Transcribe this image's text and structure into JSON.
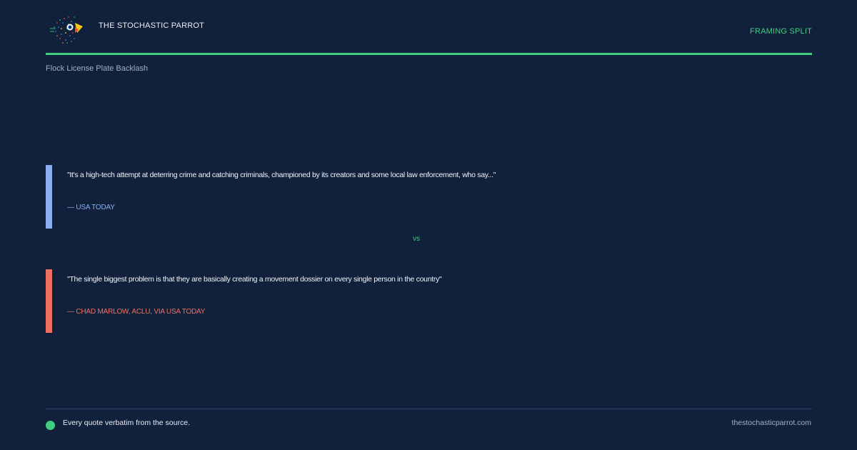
{
  "header": {
    "brand": "THE STOCHASTIC PARROT",
    "section_tag": "FRAMING SPLIT",
    "logo_icon": "parrot-logo-icon"
  },
  "topic": "Flock License Plate Backlash",
  "quotes": [
    {
      "text": "\"It's a high-tech attempt at deterring crime and catching criminals, championed by its creators and some local law enforcement, who say...\"",
      "source": "— USA TODAY",
      "accent": "#8aadef"
    },
    {
      "text": "\"The single biggest problem is that they are basically creating a movement dossier on every single person in the country\"",
      "source": "— CHAD MARLOW, ACLU, VIA USA TODAY",
      "accent": "#ef7062"
    }
  ],
  "divider": "vs",
  "footer": {
    "note": "Every quote verbatim from the source.",
    "url": "thestochasticparrot.com"
  },
  "colors": {
    "background": "#12213b",
    "accent_green": "#3ecf7f",
    "muted_text": "#9fb0c8"
  }
}
